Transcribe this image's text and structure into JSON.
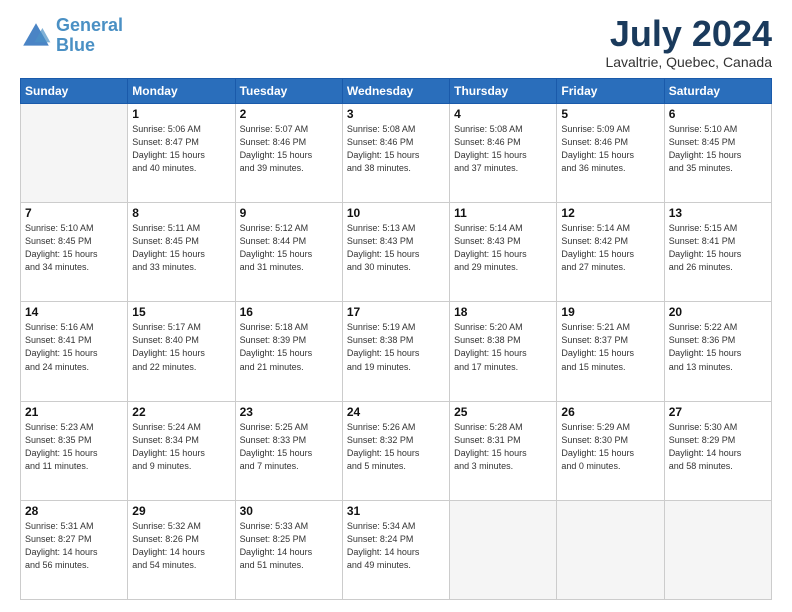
{
  "logo": {
    "line1": "General",
    "line2": "Blue"
  },
  "title": "July 2024",
  "location": "Lavaltrie, Quebec, Canada",
  "days_of_week": [
    "Sunday",
    "Monday",
    "Tuesday",
    "Wednesday",
    "Thursday",
    "Friday",
    "Saturday"
  ],
  "weeks": [
    [
      {
        "num": "",
        "info": ""
      },
      {
        "num": "1",
        "info": "Sunrise: 5:06 AM\nSunset: 8:47 PM\nDaylight: 15 hours\nand 40 minutes."
      },
      {
        "num": "2",
        "info": "Sunrise: 5:07 AM\nSunset: 8:46 PM\nDaylight: 15 hours\nand 39 minutes."
      },
      {
        "num": "3",
        "info": "Sunrise: 5:08 AM\nSunset: 8:46 PM\nDaylight: 15 hours\nand 38 minutes."
      },
      {
        "num": "4",
        "info": "Sunrise: 5:08 AM\nSunset: 8:46 PM\nDaylight: 15 hours\nand 37 minutes."
      },
      {
        "num": "5",
        "info": "Sunrise: 5:09 AM\nSunset: 8:46 PM\nDaylight: 15 hours\nand 36 minutes."
      },
      {
        "num": "6",
        "info": "Sunrise: 5:10 AM\nSunset: 8:45 PM\nDaylight: 15 hours\nand 35 minutes."
      }
    ],
    [
      {
        "num": "7",
        "info": "Sunrise: 5:10 AM\nSunset: 8:45 PM\nDaylight: 15 hours\nand 34 minutes."
      },
      {
        "num": "8",
        "info": "Sunrise: 5:11 AM\nSunset: 8:45 PM\nDaylight: 15 hours\nand 33 minutes."
      },
      {
        "num": "9",
        "info": "Sunrise: 5:12 AM\nSunset: 8:44 PM\nDaylight: 15 hours\nand 31 minutes."
      },
      {
        "num": "10",
        "info": "Sunrise: 5:13 AM\nSunset: 8:43 PM\nDaylight: 15 hours\nand 30 minutes."
      },
      {
        "num": "11",
        "info": "Sunrise: 5:14 AM\nSunset: 8:43 PM\nDaylight: 15 hours\nand 29 minutes."
      },
      {
        "num": "12",
        "info": "Sunrise: 5:14 AM\nSunset: 8:42 PM\nDaylight: 15 hours\nand 27 minutes."
      },
      {
        "num": "13",
        "info": "Sunrise: 5:15 AM\nSunset: 8:41 PM\nDaylight: 15 hours\nand 26 minutes."
      }
    ],
    [
      {
        "num": "14",
        "info": "Sunrise: 5:16 AM\nSunset: 8:41 PM\nDaylight: 15 hours\nand 24 minutes."
      },
      {
        "num": "15",
        "info": "Sunrise: 5:17 AM\nSunset: 8:40 PM\nDaylight: 15 hours\nand 22 minutes."
      },
      {
        "num": "16",
        "info": "Sunrise: 5:18 AM\nSunset: 8:39 PM\nDaylight: 15 hours\nand 21 minutes."
      },
      {
        "num": "17",
        "info": "Sunrise: 5:19 AM\nSunset: 8:38 PM\nDaylight: 15 hours\nand 19 minutes."
      },
      {
        "num": "18",
        "info": "Sunrise: 5:20 AM\nSunset: 8:38 PM\nDaylight: 15 hours\nand 17 minutes."
      },
      {
        "num": "19",
        "info": "Sunrise: 5:21 AM\nSunset: 8:37 PM\nDaylight: 15 hours\nand 15 minutes."
      },
      {
        "num": "20",
        "info": "Sunrise: 5:22 AM\nSunset: 8:36 PM\nDaylight: 15 hours\nand 13 minutes."
      }
    ],
    [
      {
        "num": "21",
        "info": "Sunrise: 5:23 AM\nSunset: 8:35 PM\nDaylight: 15 hours\nand 11 minutes."
      },
      {
        "num": "22",
        "info": "Sunrise: 5:24 AM\nSunset: 8:34 PM\nDaylight: 15 hours\nand 9 minutes."
      },
      {
        "num": "23",
        "info": "Sunrise: 5:25 AM\nSunset: 8:33 PM\nDaylight: 15 hours\nand 7 minutes."
      },
      {
        "num": "24",
        "info": "Sunrise: 5:26 AM\nSunset: 8:32 PM\nDaylight: 15 hours\nand 5 minutes."
      },
      {
        "num": "25",
        "info": "Sunrise: 5:28 AM\nSunset: 8:31 PM\nDaylight: 15 hours\nand 3 minutes."
      },
      {
        "num": "26",
        "info": "Sunrise: 5:29 AM\nSunset: 8:30 PM\nDaylight: 15 hours\nand 0 minutes."
      },
      {
        "num": "27",
        "info": "Sunrise: 5:30 AM\nSunset: 8:29 PM\nDaylight: 14 hours\nand 58 minutes."
      }
    ],
    [
      {
        "num": "28",
        "info": "Sunrise: 5:31 AM\nSunset: 8:27 PM\nDaylight: 14 hours\nand 56 minutes."
      },
      {
        "num": "29",
        "info": "Sunrise: 5:32 AM\nSunset: 8:26 PM\nDaylight: 14 hours\nand 54 minutes."
      },
      {
        "num": "30",
        "info": "Sunrise: 5:33 AM\nSunset: 8:25 PM\nDaylight: 14 hours\nand 51 minutes."
      },
      {
        "num": "31",
        "info": "Sunrise: 5:34 AM\nSunset: 8:24 PM\nDaylight: 14 hours\nand 49 minutes."
      },
      {
        "num": "",
        "info": ""
      },
      {
        "num": "",
        "info": ""
      },
      {
        "num": "",
        "info": ""
      }
    ]
  ]
}
